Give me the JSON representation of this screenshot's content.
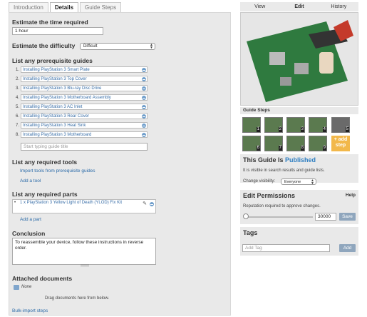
{
  "tabs": [
    "Introduction",
    "Details",
    "Guide Steps"
  ],
  "time": {
    "heading": "Estimate the time required",
    "value": "1 hour"
  },
  "difficulty": {
    "heading": "Estimate the difficulty",
    "value": "Difficult"
  },
  "prereq": {
    "heading": "List any prerequisite guides",
    "items": [
      "Installing PlayStation 3 Smart Plate",
      "Installing PlayStation 3 Top Cover",
      "Installing PlayStation 3 Blu-ray Disc Drive",
      "Installing PlayStation 3 Motherboard Assembly",
      "Installing PlayStation 3 AC Inlet",
      "Installing PlayStation 3 Rear Cover",
      "Installing PlayStation 3 Heat Sink",
      "Installing PlayStation 3 Motherboard"
    ],
    "placeholder": "Start typing guide title"
  },
  "tools": {
    "heading": "List any required tools",
    "import_link": "Import tools from prerequisite guides",
    "add_link": "Add a tool"
  },
  "parts": {
    "heading": "List any required parts",
    "item": "1 x PlayStation 3 Yellow Light of Death (YLOD) Fix Kit",
    "add_link": "Add a part"
  },
  "conclusion": {
    "heading": "Conclusion",
    "text": "To reassemble your device, follow these instructions in reverse order."
  },
  "attached": {
    "heading": "Attached documents",
    "none": "None",
    "drop_text": "Drag documents here from below.",
    "bulk_link": "Bulk-import steps"
  },
  "right_tabs": [
    "View",
    "Edit",
    "History"
  ],
  "guide_steps": {
    "label": "Guide Steps",
    "numbers": [
      "1",
      "2",
      "3",
      "4",
      "5",
      "6",
      "7",
      "8",
      "9"
    ],
    "add_label": "+ add step"
  },
  "publish": {
    "title_prefix": "This Guide Is",
    "status": "Published",
    "desc": "It is visible in search results and guide lists.",
    "visibility_label": "Change visibility:",
    "visibility_value": "Everyone"
  },
  "permissions": {
    "title": "Edit Permissions",
    "help": "Help",
    "desc": "Reputation required to approve changes.",
    "value": "30000",
    "save": "Save",
    "slider_level": 0
  },
  "tags": {
    "title": "Tags",
    "placeholder": "Add Tag",
    "add": "Add"
  },
  "colors": {
    "accent": "#2a6aa8",
    "published": "#2f7fc1",
    "add_step": "#f2b84b"
  }
}
